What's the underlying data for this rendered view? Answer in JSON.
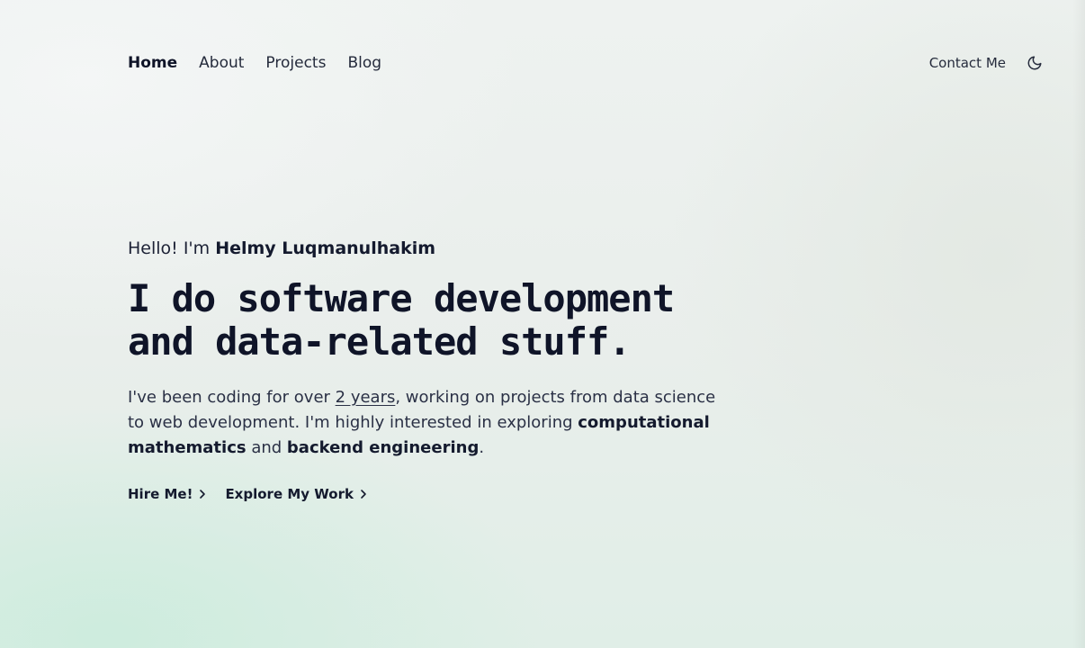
{
  "nav": {
    "links": [
      {
        "label": "Home"
      },
      {
        "label": "About"
      },
      {
        "label": "Projects"
      },
      {
        "label": "Blog"
      }
    ],
    "contact_label": "Contact Me",
    "theme_icon": "moon-icon"
  },
  "hero": {
    "greeting_prefix": "Hello! I'm ",
    "name": "Helmy Luqmanulhakim",
    "headline_line1": "I do software development",
    "headline_line2": "and data-related stuff.",
    "intro": {
      "part1": "I've been coding for over ",
      "years": "2 years",
      "part2": ", working on projects from data science to web development. I'm highly interested in exploring ",
      "topic1": "computational mathematics",
      "part3": " and ",
      "topic2": "backend engineering",
      "part4": "."
    },
    "cta_primary": "Hire Me!",
    "cta_secondary": "Explore My Work"
  }
}
